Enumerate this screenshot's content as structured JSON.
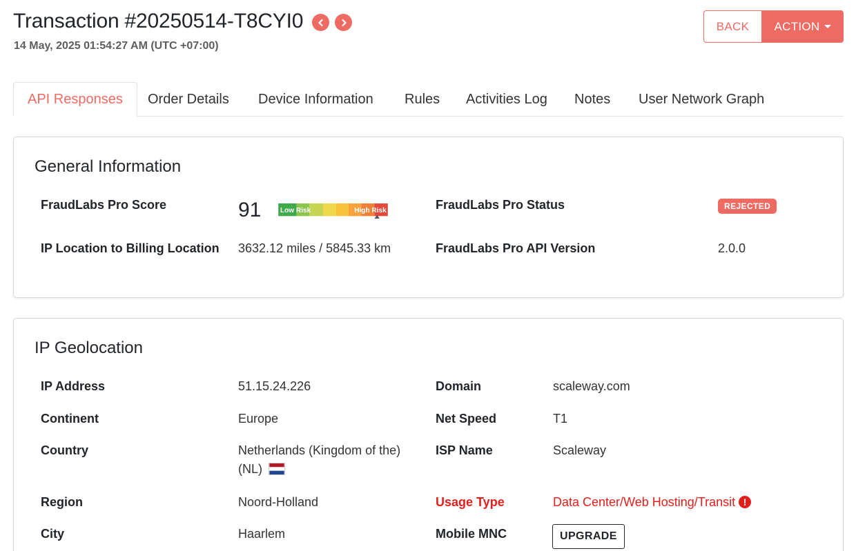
{
  "header": {
    "title": "Transaction #20250514-T8CYI0",
    "datetime": "14 May, 2025 01:54:27 AM (UTC +07:00)",
    "back_label": "BACK",
    "action_label": "ACTION"
  },
  "tabs": [
    "API Responses",
    "Order Details",
    "Device Information",
    "Rules",
    "Activities Log",
    "Notes",
    "User Network Graph"
  ],
  "general": {
    "title": "General Information",
    "score_label": "FraudLabs Pro Score",
    "score_value": "91",
    "gauge_low": "Low Risk",
    "gauge_high": "High Risk",
    "status_label": "FraudLabs Pro Status",
    "status_value": "REJECTED",
    "distance_label": "IP Location to Billing Location",
    "distance_value": "3632.12 miles / 5845.33 km",
    "api_label": "FraudLabs Pro API Version",
    "api_value": "2.0.0"
  },
  "geo": {
    "title": "IP Geolocation",
    "ip_label": "IP Address",
    "ip_value": "51.15.24.226",
    "domain_label": "Domain",
    "domain_value": "scaleway.com",
    "continent_label": "Continent",
    "continent_value": "Europe",
    "netspeed_label": "Net Speed",
    "netspeed_value": "T1",
    "country_label": "Country",
    "country_value_line1": "Netherlands (Kingdom of the)",
    "country_value_line2": "(NL)",
    "isp_label": "ISP Name",
    "isp_value": "Scaleway",
    "region_label": "Region",
    "region_value": "Noord-Holland",
    "usage_label": "Usage Type",
    "usage_value": "Data Center/Web Hosting/Transit",
    "city_label": "City",
    "city_value": "Haarlem",
    "mnc_label": "Mobile MNC",
    "mnc_button": "UPGRADE"
  },
  "colors": {
    "accent": "#ee6b63",
    "warning": "#e1201c"
  },
  "icons": [
    "chevron-left-icon",
    "chevron-right-icon",
    "caret-down-icon",
    "netherlands-flag-icon",
    "exclamation-icon"
  ]
}
